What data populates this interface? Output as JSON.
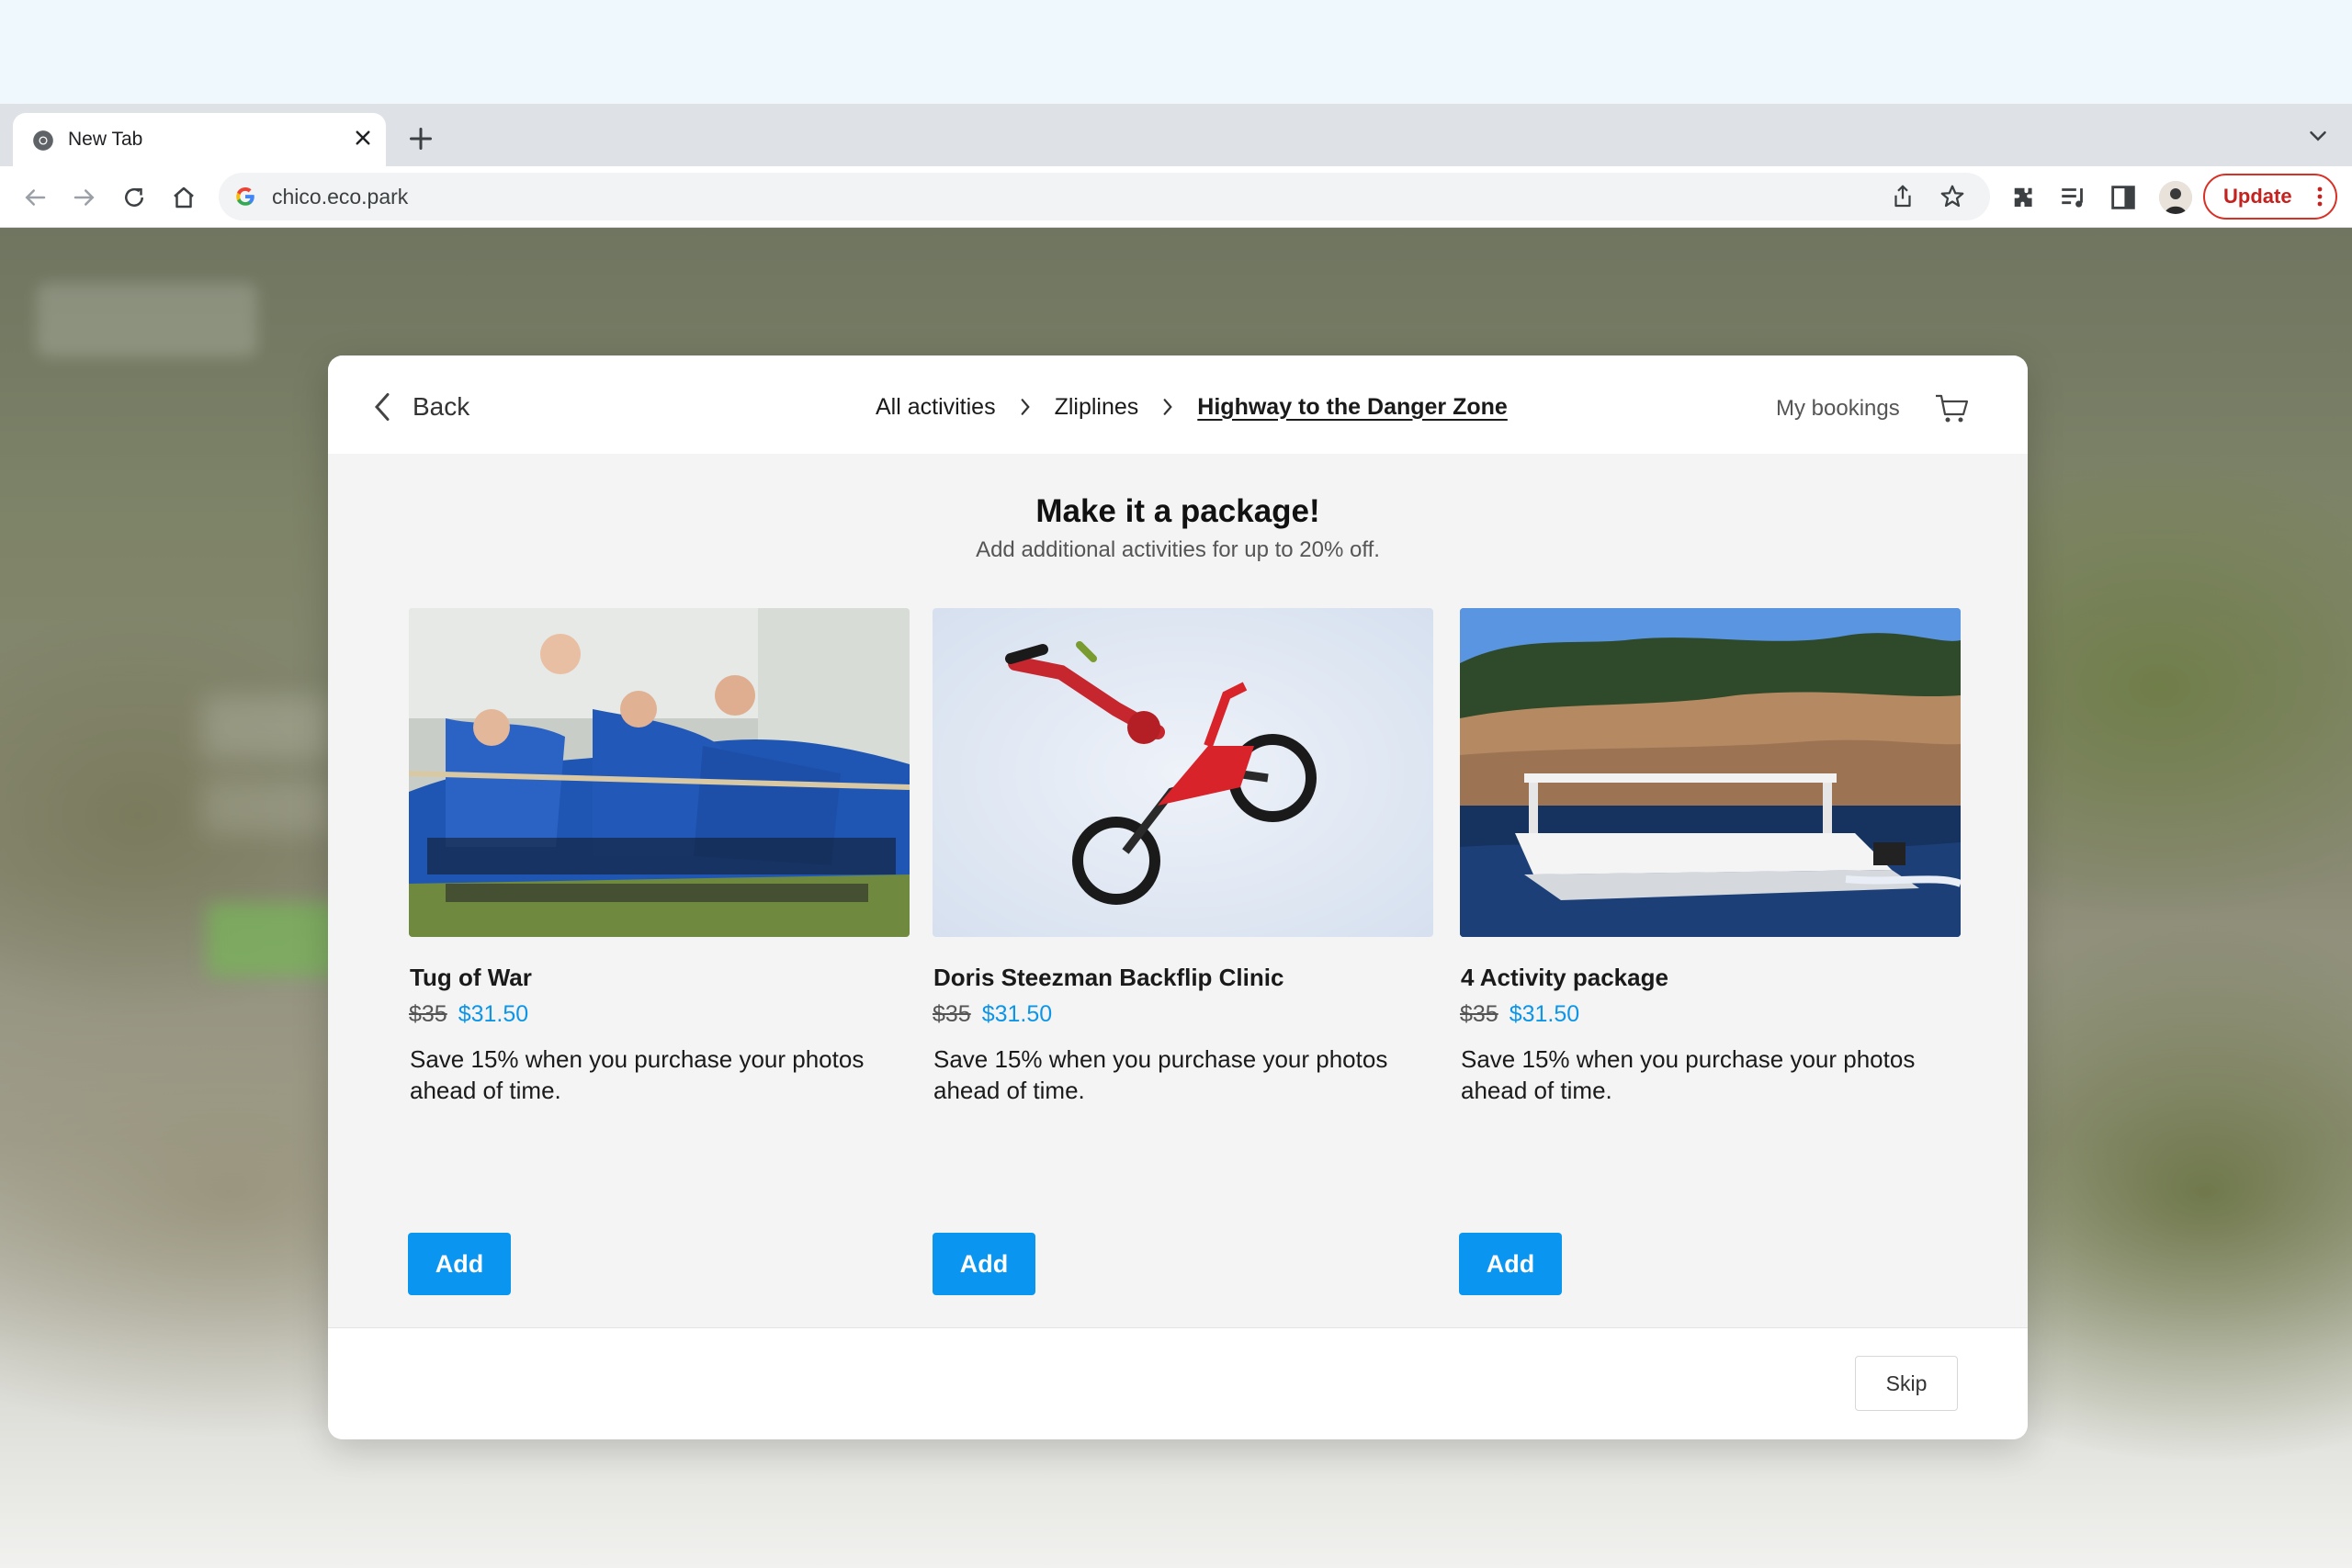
{
  "browser": {
    "tab_title": "New Tab",
    "url": "chico.eco.park",
    "update_label": "Update"
  },
  "modal": {
    "back_label": "Back",
    "breadcrumb": [
      "All activities",
      "Zliplines",
      "Highway to the Danger Zone"
    ],
    "my_bookings_label": "My bookings",
    "title": "Make it a package!",
    "subtitle": "Add additional activities for up to 20% off.",
    "cards": [
      {
        "name": "Tug of War",
        "price_old": "$35",
        "price_new": "$31.50",
        "description": "Save 15% when you purchase your photos ahead of time.",
        "button": "Add"
      },
      {
        "name": "Doris Steezman Backflip Clinic",
        "price_old": "$35",
        "price_new": "$31.50",
        "description": "Save 15% when you purchase your photos ahead of time.",
        "button": "Add"
      },
      {
        "name": "4 Activity package",
        "price_old": "$35",
        "price_new": "$31.50",
        "description": "Save 15% when you purchase your photos ahead of time.",
        "button": "Add"
      }
    ],
    "skip_label": "Skip"
  },
  "colors": {
    "accent": "#0a96f0",
    "price_new": "#0d95e8",
    "update_red": "#d93025"
  }
}
